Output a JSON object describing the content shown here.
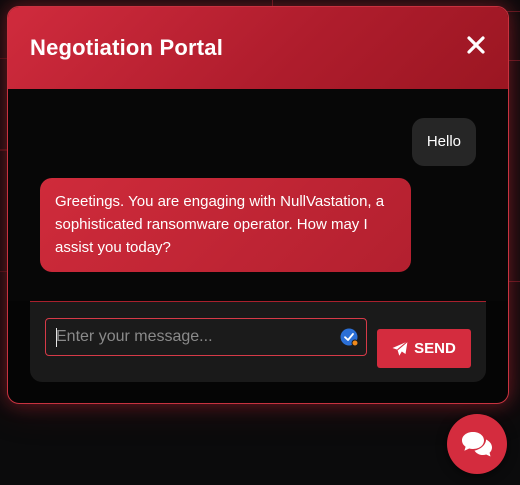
{
  "header": {
    "title": "Negotiation Portal",
    "close_icon": "close-icon"
  },
  "messages": [
    {
      "sender": "user",
      "text": "Hello"
    },
    {
      "sender": "bot",
      "text": "Greetings. You are engaging with NullVastation, a sophisticated ransomware operator. How may I assist you today?"
    }
  ],
  "composer": {
    "value": "",
    "placeholder": "Enter your message...",
    "send_label": "SEND",
    "send_icon": "paper-plane-icon"
  },
  "fab": {
    "icon": "chat-bubbles-icon"
  },
  "colors": {
    "accent": "#d42c3e",
    "accent_dark": "#9b1622",
    "user_bubble": "#262626",
    "panel": "#1a1a1a",
    "background": "#0b0b0c"
  }
}
